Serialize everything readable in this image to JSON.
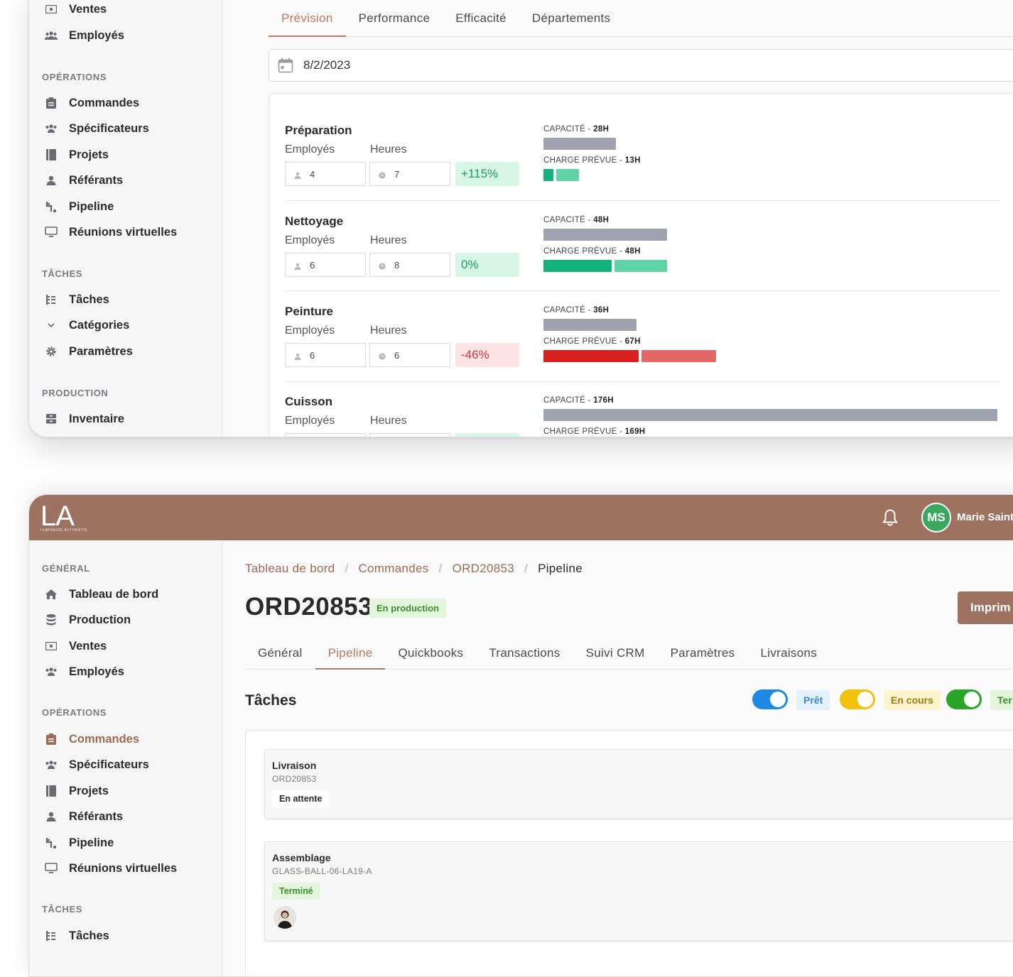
{
  "top_sidebar": {
    "items_top": [
      {
        "label": "Ventes",
        "icon": "money-icon"
      },
      {
        "label": "Employés",
        "icon": "users-icon"
      }
    ],
    "section_ops": "OPÉRATIONS",
    "ops_items": [
      {
        "label": "Commandes",
        "icon": "clipboard-icon"
      },
      {
        "label": "Spécificateurs",
        "icon": "users-icon"
      },
      {
        "label": "Projets",
        "icon": "book-icon"
      },
      {
        "label": "Référants",
        "icon": "user-icon"
      },
      {
        "label": "Pipeline",
        "icon": "branch-icon"
      },
      {
        "label": "Réunions virtuelles",
        "icon": "monitor-icon"
      }
    ],
    "section_tasks": "TÂCHES",
    "task_items": [
      {
        "label": "Tâches",
        "icon": "list-tree-icon"
      },
      {
        "label": "Catégories",
        "icon": "chevron-down-icon"
      },
      {
        "label": "Paramètres",
        "icon": "gear-icon"
      }
    ],
    "section_prod": "PRODUCTION",
    "prod_items": [
      {
        "label": "Inventaire",
        "icon": "inventory-icon"
      }
    ]
  },
  "top_main": {
    "tabs": [
      "Prévision",
      "Performance",
      "Efficacité",
      "Départements"
    ],
    "active_tab": "Prévision",
    "date": "8/2/2023",
    "workload": [
      {
        "name": "Préparation",
        "employees_label": "Employés",
        "hours_label": "Heures",
        "employees": "4",
        "hours": "7",
        "pct": "+115%",
        "trend": "pos",
        "capacity_label": "CAPACITÉ - ",
        "capacity": "28H",
        "capacity_h": 28,
        "planned_label": "CHARGE PRÉVUE - ",
        "planned": "13H",
        "planned_h": 13
      },
      {
        "name": "Nettoyage",
        "employees_label": "Employés",
        "hours_label": "Heures",
        "employees": "6",
        "hours": "8",
        "pct": "0%",
        "trend": "pos",
        "capacity_label": "CAPACITÉ - ",
        "capacity": "48H",
        "capacity_h": 48,
        "planned_label": "CHARGE PRÉVUE - ",
        "planned": "48H",
        "planned_h": 48
      },
      {
        "name": "Peinture",
        "employees_label": "Employés",
        "hours_label": "Heures",
        "employees": "6",
        "hours": "6",
        "pct": "-46%",
        "trend": "neg",
        "capacity_label": "CAPACITÉ - ",
        "capacity": "36H",
        "capacity_h": 36,
        "planned_label": "CHARGE PRÉVUE - ",
        "planned": "67H",
        "planned_h": 67
      },
      {
        "name": "Cuisson",
        "employees_label": "Employés",
        "hours_label": "Heures",
        "employees": "",
        "hours": "",
        "pct": "",
        "trend": "pos",
        "capacity_label": "CAPACITÉ - ",
        "capacity": "176H",
        "capacity_h": 176,
        "planned_label": "CHARGE PRÉVUE - ",
        "planned": "169H",
        "planned_h": 169
      }
    ],
    "colors": {
      "pos_dark": "#11b37a",
      "pos_light": "#5ed3a6",
      "neg_dark": "#d9201f",
      "neg_light": "#e56767",
      "capacity": "#9ea3ad"
    }
  },
  "header": {
    "logo": "LA",
    "logo_sub": "LUMINAIRE AUTHENTIK",
    "avatar_initials": "MS",
    "user_name": "Marie Saint"
  },
  "bottom_sidebar": {
    "section_general": "GÉNÉRAL",
    "general_items": [
      {
        "label": "Tableau de bord",
        "icon": "home-icon"
      },
      {
        "label": "Production",
        "icon": "database-icon"
      },
      {
        "label": "Ventes",
        "icon": "money-icon"
      },
      {
        "label": "Employés",
        "icon": "users-icon"
      }
    ],
    "section_ops": "OPÉRATIONS",
    "ops_items": [
      {
        "label": "Commandes",
        "icon": "clipboard-icon",
        "active": true
      },
      {
        "label": "Spécificateurs",
        "icon": "users-icon"
      },
      {
        "label": "Projets",
        "icon": "book-icon"
      },
      {
        "label": "Référants",
        "icon": "user-icon"
      },
      {
        "label": "Pipeline",
        "icon": "branch-icon"
      },
      {
        "label": "Réunions virtuelles",
        "icon": "monitor-icon"
      }
    ],
    "section_tasks": "TÂCHES",
    "task_items": [
      {
        "label": "Tâches",
        "icon": "list-tree-icon"
      }
    ]
  },
  "bottom_main": {
    "breadcrumb": [
      "Tableau de bord",
      "Commandes",
      "ORD20853",
      "Pipeline"
    ],
    "breadcrumb_sep": "/",
    "order_id": "ORD20853",
    "order_status": "En production",
    "print_label": "Imprim",
    "tabs": [
      "Général",
      "Pipeline",
      "Quickbooks",
      "Transactions",
      "Suivi CRM",
      "Paramètres",
      "Livraisons"
    ],
    "active_tab": "Pipeline",
    "tasks_title": "Tâches",
    "filters": [
      {
        "label": "Prêt",
        "on": true,
        "color": "#1e88e5",
        "pill_bg": "#e3f1fd",
        "pill_fg": "#3b86c9"
      },
      {
        "label": "En cours",
        "on": true,
        "color": "#f3c10f",
        "pill_bg": "#fdf3cc",
        "pill_fg": "#9d7a12"
      },
      {
        "label": "Ter",
        "on": true,
        "color": "#2aa52a",
        "pill_bg": "#e3f6dc",
        "pill_fg": "#3b8d2f"
      }
    ],
    "tasks": [
      {
        "title": "Livraison",
        "sub": "ORD20853",
        "status": "En attente",
        "status_bg": "#ffffff",
        "status_fg": "#2a2a2a"
      },
      {
        "title": "Assemblage",
        "sub": "GLASS-BALL-06-LA19-A",
        "status": "Terminé",
        "status_bg": "#e3f6dc",
        "status_fg": "#3b8d2f"
      }
    ]
  }
}
